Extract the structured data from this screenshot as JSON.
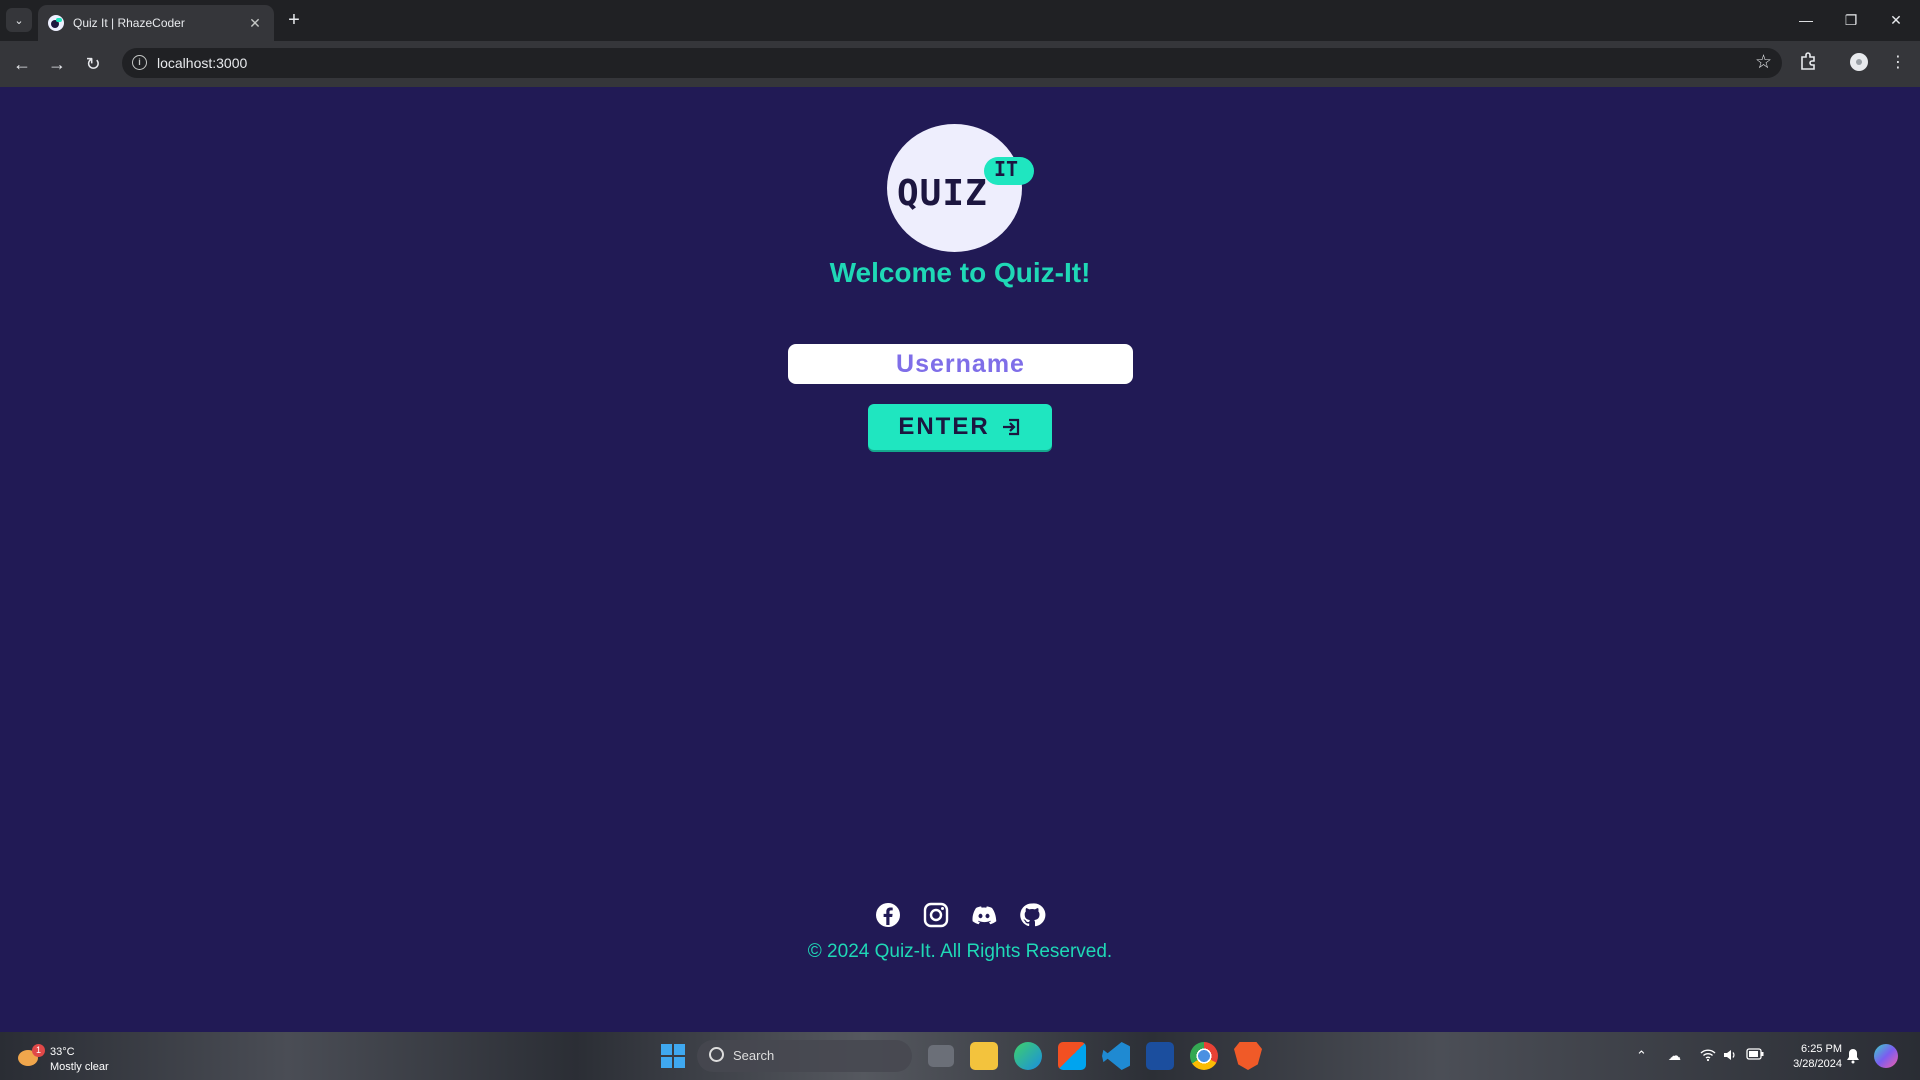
{
  "browser": {
    "tab_title": "Quiz It | RhazeCoder",
    "url": "localhost:3000"
  },
  "logo": {
    "main_text": "QUIZ",
    "bubble_text": "IT"
  },
  "page": {
    "welcome": "Welcome to Quiz-It!",
    "username_placeholder": "Username",
    "enter_label": "ENTER",
    "copyright": "© 2024 Quiz-It. All Rights Reserved."
  },
  "social_icons": [
    "facebook-icon",
    "instagram-icon",
    "discord-icon",
    "github-icon"
  ],
  "taskbar": {
    "weather_temp": "33°C",
    "weather_condition": "Mostly clear",
    "weather_badge": "1",
    "search_label": "Search",
    "time": "6:25 PM",
    "date": "3/28/2024"
  },
  "colors": {
    "background": "#211a55",
    "accent": "#1fe6c0",
    "placeholder": "#7f6ee8"
  }
}
